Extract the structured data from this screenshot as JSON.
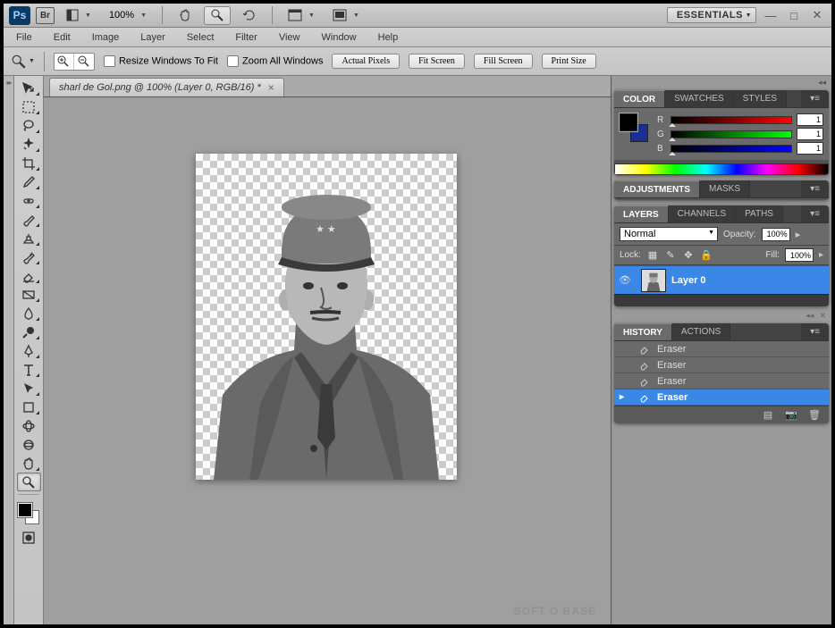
{
  "titlebar": {
    "zoom_value": "100%",
    "workspace_label": "ESSENTIALS"
  },
  "menu": {
    "file": "File",
    "edit": "Edit",
    "image": "Image",
    "layer": "Layer",
    "select": "Select",
    "filter": "Filter",
    "view": "View",
    "window": "Window",
    "help": "Help"
  },
  "options_bar": {
    "resize_windows": "Resize Windows To Fit",
    "zoom_all": "Zoom All Windows",
    "actual_pixels": "Actual Pixels",
    "fit_screen": "Fit Screen",
    "fill_screen": "Fill Screen",
    "print_size": "Print Size"
  },
  "document": {
    "tab_title": "sharl de Gol.png @ 100% (Layer 0, RGB/16) *"
  },
  "color_panel": {
    "tabs": {
      "color": "COLOR",
      "swatches": "SWATCHES",
      "styles": "STYLES"
    },
    "channels": {
      "r_label": "R",
      "g_label": "G",
      "b_label": "B"
    },
    "values": {
      "r": "1",
      "g": "1",
      "b": "1"
    }
  },
  "adjust_panel": {
    "tabs": {
      "adjustments": "ADJUSTMENTS",
      "masks": "MASKS"
    }
  },
  "layers_panel": {
    "tabs": {
      "layers": "LAYERS",
      "channels": "CHANNELS",
      "paths": "PATHS"
    },
    "blend_mode": "Normal",
    "opacity_label": "Opacity:",
    "opacity_value": "100%",
    "lock_label": "Lock:",
    "fill_label": "Fill:",
    "fill_value": "100%",
    "layer0_name": "Layer 0"
  },
  "history_panel": {
    "tabs": {
      "history": "HISTORY",
      "actions": "ACTIONS"
    },
    "items": [
      "Eraser",
      "Eraser",
      "Eraser",
      "Eraser"
    ]
  },
  "watermark": "SOFT O BASE"
}
